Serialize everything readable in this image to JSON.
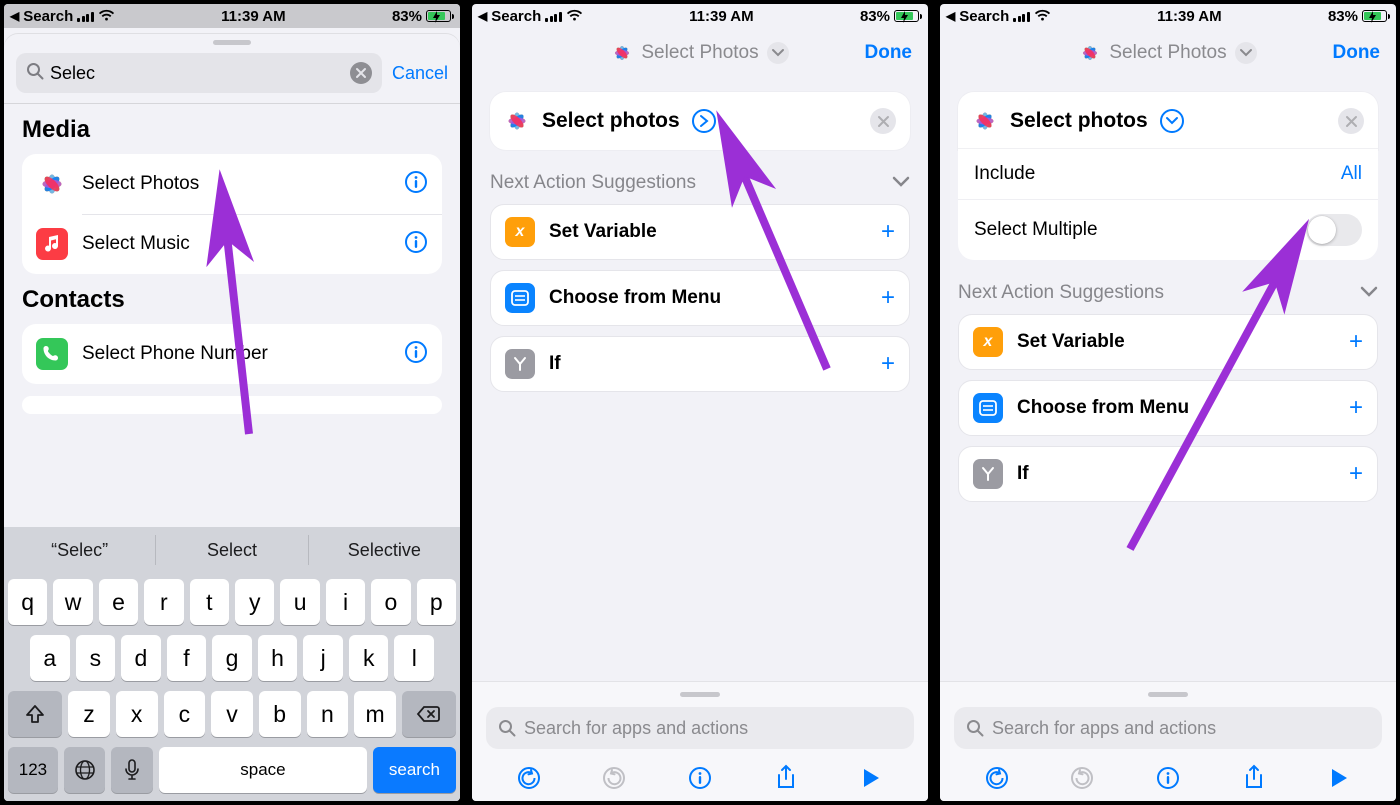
{
  "status": {
    "back": "Search",
    "time": "11:39 AM",
    "batteryPct": "83%",
    "batteryFill": 83
  },
  "s1": {
    "searchValue": "Selec",
    "cancel": "Cancel",
    "sections": [
      {
        "title": "Media",
        "rows": [
          {
            "label": "Select Photos",
            "icon": "photos"
          },
          {
            "label": "Select Music",
            "icon": "music"
          }
        ]
      },
      {
        "title": "Contacts",
        "rows": [
          {
            "label": "Select Phone Number",
            "icon": "phone"
          }
        ]
      }
    ],
    "suggestions": [
      "“Selec”",
      "Select",
      "Selective"
    ],
    "keys_r1": [
      "q",
      "w",
      "e",
      "r",
      "t",
      "y",
      "u",
      "i",
      "o",
      "p"
    ],
    "keys_r2": [
      "a",
      "s",
      "d",
      "f",
      "g",
      "h",
      "j",
      "k",
      "l"
    ],
    "keys_r3": [
      "z",
      "x",
      "c",
      "v",
      "b",
      "n",
      "m"
    ],
    "fn123": "123",
    "space": "space",
    "search": "search"
  },
  "s2": {
    "headerTitle": "Select Photos",
    "done": "Done",
    "cardTitle": "Select photos",
    "nasTitle": "Next Action Suggestions",
    "suggestions": [
      {
        "label": "Set Variable",
        "bg": "#ff9f0a",
        "glyph": "x"
      },
      {
        "label": "Choose from Menu",
        "bg": "#0a84ff",
        "glyph": "menu"
      },
      {
        "label": "If",
        "bg": "#9b9ba2",
        "glyph": "Y"
      }
    ],
    "searchPlaceholder": "Search for apps and actions"
  },
  "s3": {
    "headerTitle": "Select Photos",
    "done": "Done",
    "cardTitle": "Select photos",
    "includeLabel": "Include",
    "includeValue": "All",
    "selectMultipleLabel": "Select Multiple",
    "nasTitle": "Next Action Suggestions",
    "suggestions": [
      {
        "label": "Set Variable",
        "bg": "#ff9f0a",
        "glyph": "x"
      },
      {
        "label": "Choose from Menu",
        "bg": "#0a84ff",
        "glyph": "menu"
      },
      {
        "label": "If",
        "bg": "#9b9ba2",
        "glyph": "Y"
      }
    ],
    "searchPlaceholder": "Search for apps and actions"
  }
}
